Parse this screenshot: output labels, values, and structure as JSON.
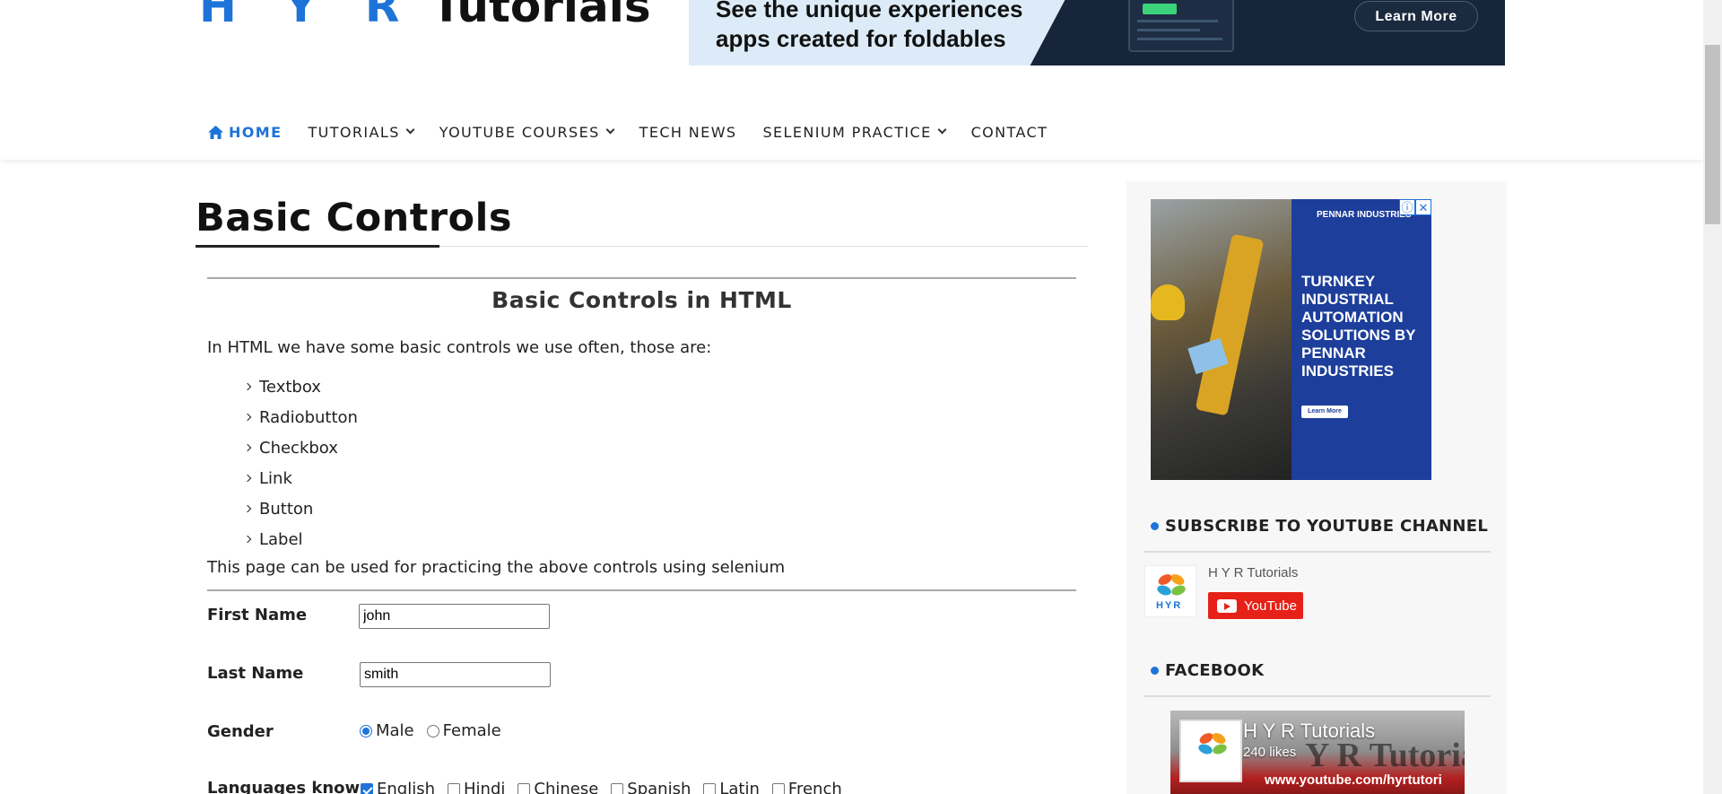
{
  "header": {
    "logo_hyr": "H Y R",
    "logo_tutorials": "Tutorials",
    "ad": {
      "line1": "See the unique experiences",
      "line2": "apps created for foldables",
      "button": "Learn More"
    }
  },
  "nav": {
    "items": [
      {
        "label": "HOME",
        "icon": "home-icon",
        "active": true
      },
      {
        "label": "TUTORIALS",
        "dropdown": true
      },
      {
        "label": "YOUTUBE COURSES",
        "dropdown": true
      },
      {
        "label": "TECH NEWS"
      },
      {
        "label": "SELENIUM PRACTICE",
        "dropdown": true
      },
      {
        "label": "CONTACT"
      }
    ]
  },
  "main": {
    "page_title": "Basic Controls",
    "section_title": "Basic Controls in HTML",
    "intro": "In HTML we have some basic controls we use often, those are:",
    "controls": [
      "Textbox",
      "Radiobutton",
      "Checkbox",
      "Link",
      "Button",
      "Label"
    ],
    "practice_note": "This page can be used for practicing the above controls using selenium",
    "form": {
      "first_name_label": "First Name",
      "first_name_value": "john",
      "last_name_label": "Last Name",
      "last_name_value": "smith",
      "gender_label": "Gender",
      "gender_options": [
        {
          "label": "Male",
          "checked": true
        },
        {
          "label": "Female",
          "checked": false
        }
      ],
      "languages_label": "Languages known",
      "languages": [
        {
          "label": "English",
          "checked": true
        },
        {
          "label": "Hindi",
          "checked": false
        },
        {
          "label": "Chinese",
          "checked": false
        },
        {
          "label": "Spanish",
          "checked": false
        },
        {
          "label": "Latin",
          "checked": false
        },
        {
          "label": "French",
          "checked": false
        }
      ]
    }
  },
  "sidebar": {
    "ad": {
      "brand": "PENNAR INDUSTRIES",
      "headline": "TURNKEY INDUSTRIAL AUTOMATION SOLUTIONS BY PENNAR INDUSTRIES",
      "button": "Learn More"
    },
    "subscribe_heading": "SUBSCRIBE TO YOUTUBE CHANNEL",
    "channel_name": "H Y R Tutorials",
    "youtube_button": "YouTube",
    "logo_text": "HYR",
    "facebook_heading": "FACEBOOK",
    "fb_page_name": "H Y R Tutorials",
    "fb_likes": "240 likes",
    "fb_banner_text": "Y R Tutoria",
    "fb_banner_url": "www.youtube.com/hyrtutori"
  },
  "colors": {
    "accent": "#1e73d8",
    "youtube_red": "#e62117"
  }
}
